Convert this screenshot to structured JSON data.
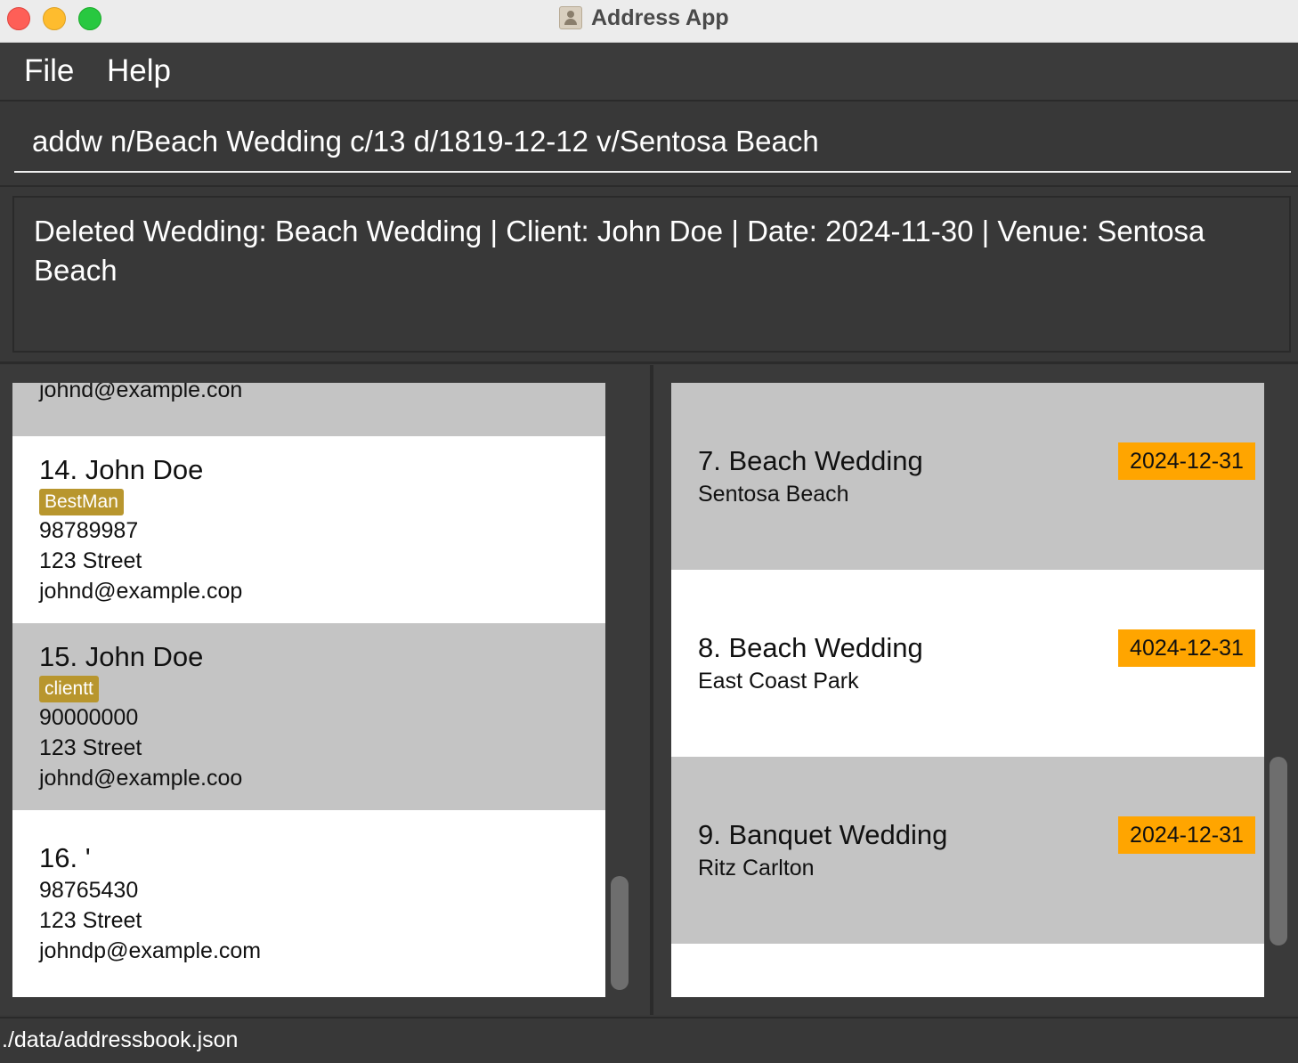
{
  "window": {
    "title": "Address App"
  },
  "menu": {
    "file": "File",
    "help": "Help"
  },
  "command": {
    "value": "addw n/Beach Wedding c/13 d/1819-12-12 v/Sentosa Beach"
  },
  "result": {
    "line1": "Deleted Wedding: Beach Wedding | Client: John Doe | Date: 2024-11-30 | Venue: Sentosa",
    "line2": "Beach"
  },
  "persons": [
    {
      "email": "johnd@example.con"
    },
    {
      "name": "14. John Doe",
      "tag": "BestMan",
      "phone": "98789987",
      "address": "123 Street",
      "email": "johnd@example.cop"
    },
    {
      "name": "15. John Doe",
      "tag": "clientt",
      "phone": "90000000",
      "address": "123 Street",
      "email": "johnd@example.coo"
    },
    {
      "name": "16. '",
      "phone": "98765430",
      "address": "123 Street",
      "email": "johndp@example.com"
    }
  ],
  "weddings": [
    {
      "name": "7. Beach Wedding",
      "venue": "Sentosa Beach",
      "date": "2024-12-31"
    },
    {
      "name": "8. Beach Wedding",
      "venue": "East Coast Park",
      "date": "4024-12-31"
    },
    {
      "name": "9. Banquet Wedding",
      "venue": "Ritz Carlton",
      "date": "2024-12-31"
    }
  ],
  "status": {
    "path": "./data/addressbook.json"
  },
  "colors": {
    "tag": "#b8962e",
    "date_badge": "#ffa500",
    "card_grey": "#c4c4c4",
    "background": "#383838"
  }
}
